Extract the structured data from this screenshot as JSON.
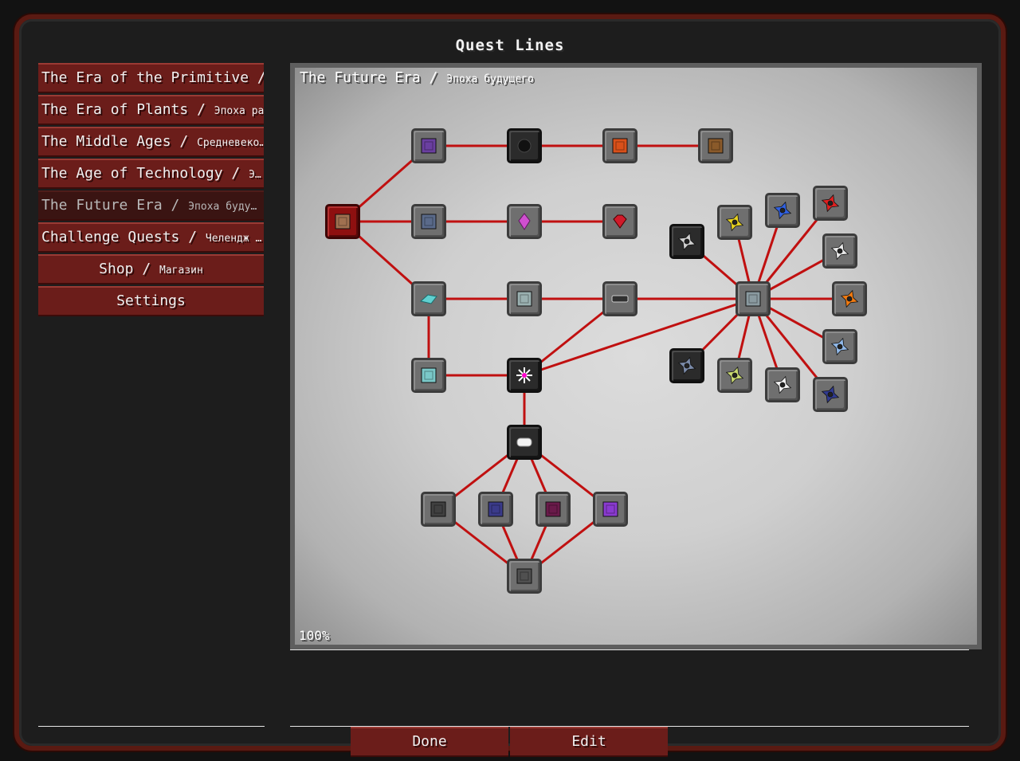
{
  "window": {
    "title": "Quest Lines"
  },
  "sidebar": {
    "items": [
      {
        "label": "The Era of the Primitive / ",
        "sub": "…"
      },
      {
        "label": "The Era of Plants / ",
        "sub": "Эпоха ра…"
      },
      {
        "label": "The Middle Ages / ",
        "sub": "Средневеко…"
      },
      {
        "label": "The Age of Technology / ",
        "sub": "Э…"
      },
      {
        "label": "The Future Era / ",
        "sub": "Эпоха буду…"
      },
      {
        "label": "Challenge Quests / ",
        "sub": "Челендж …"
      },
      {
        "label": "Shop / ",
        "sub": "Магазин"
      },
      {
        "label": "Settings",
        "sub": ""
      }
    ]
  },
  "canvas": {
    "title": "The Future Era / ",
    "subtitle": "Эпоха будущего",
    "zoom": "100%"
  },
  "colors": {
    "accent": "#6b1d1a",
    "edge": "#c01010"
  },
  "quests": [
    {
      "id": "q1",
      "icon": "machine-icon",
      "color": "#6a3fa0"
    },
    {
      "id": "q2",
      "icon": "black-orb-icon",
      "color": "#111111"
    },
    {
      "id": "q3",
      "icon": "lava-block-icon",
      "color": "#d9501a"
    },
    {
      "id": "q4",
      "icon": "furnace-icon",
      "color": "#8a5a2a"
    },
    {
      "id": "q5",
      "icon": "wood-block-icon",
      "color": "#a07050"
    },
    {
      "id": "q6",
      "icon": "frame-block-icon",
      "color": "#5a6a8a"
    },
    {
      "id": "q7",
      "icon": "pink-crystal-icon",
      "color": "#d04fd0"
    },
    {
      "id": "q8",
      "icon": "red-gem-icon",
      "color": "#d01a2a"
    },
    {
      "id": "q9",
      "icon": "crystal-tool-icon",
      "color": "#60d0d0"
    },
    {
      "id": "q10",
      "icon": "metal-casing-icon",
      "color": "#9ab0b0"
    },
    {
      "id": "q11",
      "icon": "conveyor-icon",
      "color": "#303030"
    },
    {
      "id": "q12",
      "icon": "teal-block-icon",
      "color": "#7ac8c8"
    },
    {
      "id": "q13",
      "icon": "star-burst-icon",
      "color": "#ffffff"
    },
    {
      "id": "q14",
      "icon": "white-ingot-icon",
      "color": "#f4f4f4"
    },
    {
      "id": "q15",
      "icon": "dark-cube-icon",
      "color": "#404040"
    },
    {
      "id": "q16",
      "icon": "blue-cube-icon",
      "color": "#3a3a8a"
    },
    {
      "id": "q17",
      "icon": "red-cube-icon",
      "color": "#6a1a4a"
    },
    {
      "id": "q18",
      "icon": "purple-cube-icon",
      "color": "#8a3ad0"
    },
    {
      "id": "q19",
      "icon": "stone-block-icon",
      "color": "#505050"
    },
    {
      "id": "q20",
      "icon": "machine-hub-icon",
      "color": "#8a9aa0"
    },
    {
      "id": "s1",
      "icon": "shuriken-gray-icon",
      "color": "#cfcfcf"
    },
    {
      "id": "s2",
      "icon": "shuriken-yellow-icon",
      "color": "#e6d020"
    },
    {
      "id": "s3",
      "icon": "shuriken-blue-icon",
      "color": "#3060e0"
    },
    {
      "id": "s4",
      "icon": "shuriken-red-icon",
      "color": "#e02020"
    },
    {
      "id": "s5",
      "icon": "shuriken-white-icon",
      "color": "#e8e8e8"
    },
    {
      "id": "s6",
      "icon": "shuriken-orange-icon",
      "color": "#f07a10"
    },
    {
      "id": "s7",
      "icon": "shuriken-lightblue-icon",
      "color": "#90b8e8"
    },
    {
      "id": "s8",
      "icon": "shuriken-indigo-icon",
      "color": "#303a90"
    },
    {
      "id": "s9",
      "icon": "shuriken-silver-icon",
      "color": "#f0f0f0"
    },
    {
      "id": "s10",
      "icon": "shuriken-lime-icon",
      "color": "#c8d870"
    },
    {
      "id": "s11",
      "icon": "shuriken-steel-icon",
      "color": "#7a8aa8"
    }
  ],
  "buttons": {
    "done": "Done",
    "edit": "Edit"
  }
}
